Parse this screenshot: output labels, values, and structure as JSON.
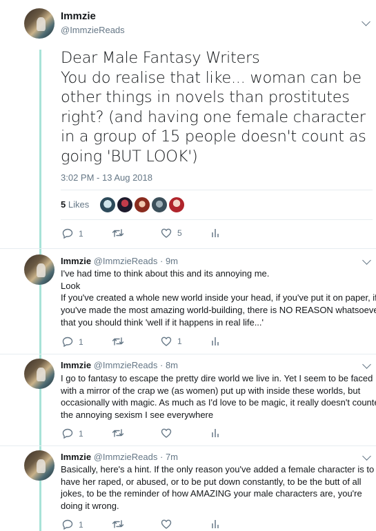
{
  "main_tweet": {
    "name": "Immzie",
    "handle": "@ImmzieReads",
    "lines": [
      "Dear Male Fantasy Writers",
      "You do realise that like... woman can be",
      "other things in novels than prostitutes",
      "right? (and having one female character",
      "in a group of 15 people doesn't count as",
      "going 'BUT LOOK')"
    ],
    "timestamp": "3:02 PM - 13 Aug 2018",
    "likes_count": "5",
    "likes_label": "Likes",
    "reply_count": "1",
    "like_count": "5"
  },
  "replies": [
    {
      "name": "Immzie",
      "handle": "@ImmzieReads",
      "time": "9m",
      "lines": [
        "I've had time to think about this and its annoying me.",
        "Look",
        "If you've created a whole new world inside your head, if you've put it on paper, if",
        "you've made the most amazing world-building, there is NO REASON whatsoever",
        "that you should think 'well if it happens in real life...'"
      ],
      "reply_count": "1",
      "like_count": "1"
    },
    {
      "name": "Immzie",
      "handle": "@ImmzieReads",
      "time": "8m",
      "lines": [
        "I go to fantasy to escape the pretty dire world we live in. Yet I seem to be faced",
        "with a mirror of the crap we (as women) put up with inside these worlds, but",
        "occasionally with magic. As much as I'd love to be magic, it really doesn't counter",
        "the annoying sexism I see everywhere"
      ],
      "reply_count": "1",
      "like_count": ""
    },
    {
      "name": "Immzie",
      "handle": "@ImmzieReads",
      "time": "7m",
      "lines": [
        "Basically, here's a hint. If the only reason you've added a female character is to",
        "have her raped, or abused, or to be put down constantly, to be the butt of all",
        "jokes, to be the reminder of how AMAZING your male characters are, you're",
        "doing it wrong."
      ],
      "reply_count": "1",
      "like_count": ""
    }
  ],
  "separator": " · ",
  "icons": [
    "reply-icon",
    "retweet-icon",
    "like-icon",
    "analytics-icon",
    "chevron-down-icon"
  ],
  "colors": {
    "thread_line": "#a8e3d8",
    "secondary_text": "#657786",
    "primary_text": "#14171a"
  }
}
